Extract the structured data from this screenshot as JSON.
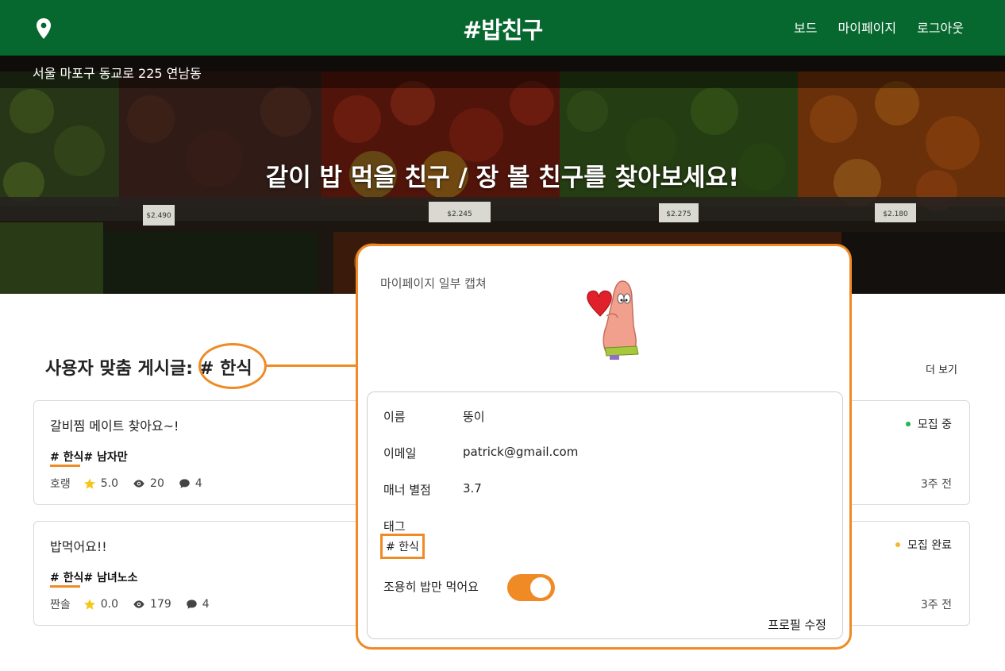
{
  "header": {
    "logo": "#밥친구",
    "nav": [
      "보드",
      "마이페이지",
      "로그아웃"
    ]
  },
  "hero": {
    "address": "서울 마포구 동교로 225 연남동",
    "title": "같이 밥 먹을 친구 / 장 볼 친구를 찾아보세요!",
    "price_tags": [
      "$2.490",
      "$2.245",
      "$2.275",
      "$2.180"
    ]
  },
  "section": {
    "title_prefix": "사용자 맞춤 게시글:",
    "title_tag": "# 한식",
    "more": "더 보기"
  },
  "posts": [
    {
      "title": "갈비찜 메이트 찾아요~!",
      "tags": "# 한식# 남자만",
      "author": "호랭",
      "rating": "5.0",
      "views": "20",
      "comments": "4",
      "status": "모집 중",
      "status_color": "#1db954",
      "time": "3주 전"
    },
    {
      "title": "밥먹어요!!",
      "tags": "# 한식# 남녀노소",
      "author": "짠솔",
      "rating": "0.0",
      "views": "179",
      "comments": "4",
      "status": "모집 완료",
      "status_color": "#f5b82e",
      "time": "3주 전"
    }
  ],
  "overlay": {
    "caption": "마이페이지 일부 캡쳐",
    "name_label": "이름",
    "name_value": "뚱이",
    "email_label": "이메일",
    "email_value": "patrick@gmail.com",
    "manner_label": "매너 별점",
    "manner_value": "3.7",
    "tag_label": "태그",
    "tag_value": "# 한식",
    "quiet_label": "조용히 밥만 먹어요",
    "quiet_on": true,
    "edit": "프로필 수정"
  },
  "colors": {
    "header_green": "#06672f",
    "accent_orange": "#f08a24",
    "star_yellow": "#f5c518"
  },
  "icons": {
    "location": "map-pin-icon",
    "star": "star-icon",
    "views": "eye-icon",
    "comments": "comment-icon"
  }
}
